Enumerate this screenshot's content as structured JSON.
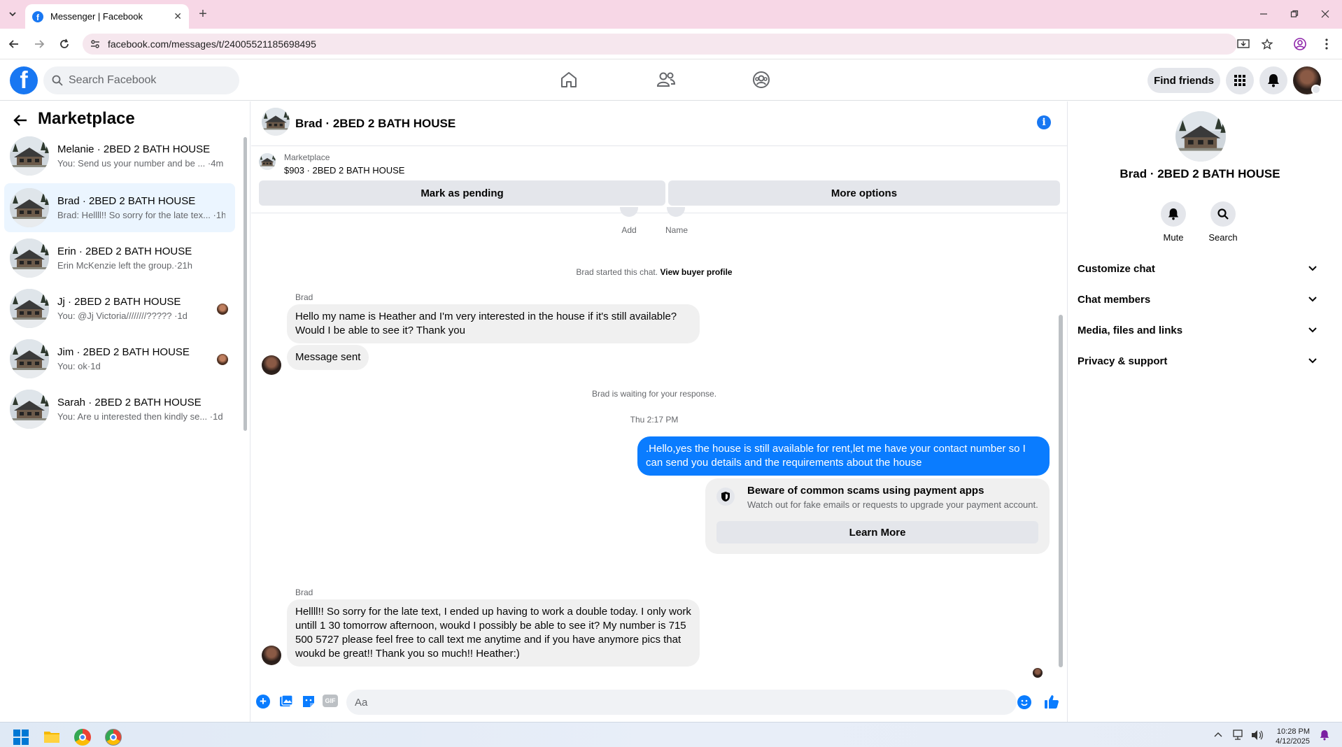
{
  "browser": {
    "tab_title": "Messenger | Facebook",
    "url": "facebook.com/messages/t/24005521185698495",
    "new_tab_symbol": "+"
  },
  "fb_nav": {
    "logo_letter": "f",
    "search_placeholder": "Search Facebook",
    "find_friends": "Find friends"
  },
  "left_panel": {
    "title": "Marketplace",
    "conversations": [
      {
        "name": "Melanie · 2BED 2 BATH HOUSE",
        "preview": "You: Send us your number and be ... ·4m"
      },
      {
        "name": "Brad · 2BED 2 BATH HOUSE",
        "preview": "Brad: Hellll!! So sorry for the late tex... ·1h"
      },
      {
        "name": "Erin · 2BED 2 BATH HOUSE",
        "preview": "Erin McKenzie left the group.·21h"
      },
      {
        "name": "Jj · 2BED 2 BATH HOUSE",
        "preview": "You: @Jj Victoria////////????? ·1d"
      },
      {
        "name": "Jim · 2BED 2 BATH HOUSE",
        "preview": "You: ok·1d"
      },
      {
        "name": "Sarah · 2BED 2 BATH HOUSE",
        "preview": "You: Are u interested then kindly se... ·1d"
      }
    ]
  },
  "chat": {
    "title": "Brad · 2BED 2 BATH HOUSE",
    "marketplace_label": "Marketplace",
    "listing": "$903 · 2BED 2 BATH HOUSE",
    "mark_pending": "Mark as pending",
    "more_options": "More options",
    "add_label": "Add",
    "name_label": "Name",
    "started_text": "Brad started this chat.",
    "view_buyer_profile": "View buyer profile",
    "sender1": "Brad",
    "msg1": "Hello my name is Heather and I'm very interested in the house if it's still available? Would I be able to see it? Thank you",
    "msg2": "Message sent",
    "waiting": "Brad is waiting for your response.",
    "timestamp": "Thu 2:17 PM",
    "msg3": ".Hello,yes the house is still available for rent,let me have your contact number   so I can send you details and the requirements about the house",
    "scam_title": "Beware of common scams using payment apps",
    "scam_body": "Watch out for fake emails or requests to upgrade your payment account.",
    "learn_more": "Learn More",
    "sender2": "Brad",
    "msg4": "Hellll!! So sorry for the late text, I  ended up having to work a double today. I only work untill 1 30 tomorrow afternoon, woukd I possibly be able to see it? My number is 715 500 5727 please feel free to call text me anytime and if you have anymore pics that woukd be great!! Thank you so much!! Heather:)",
    "input_placeholder": "Aa"
  },
  "right_panel": {
    "name": "Brad · 2BED 2 BATH HOUSE",
    "mute": "Mute",
    "search": "Search",
    "items": [
      "Customize chat",
      "Chat members",
      "Media, files and links",
      "Privacy & support"
    ]
  },
  "taskbar": {
    "time": "10:28 PM",
    "date": "4/12/2025"
  },
  "colors": {
    "fb_blue": "#1877f2",
    "outgoing_bubble": "#0a7cff",
    "active_conv": "#ebf5ff",
    "tab_strip": "#f7d7e6"
  }
}
